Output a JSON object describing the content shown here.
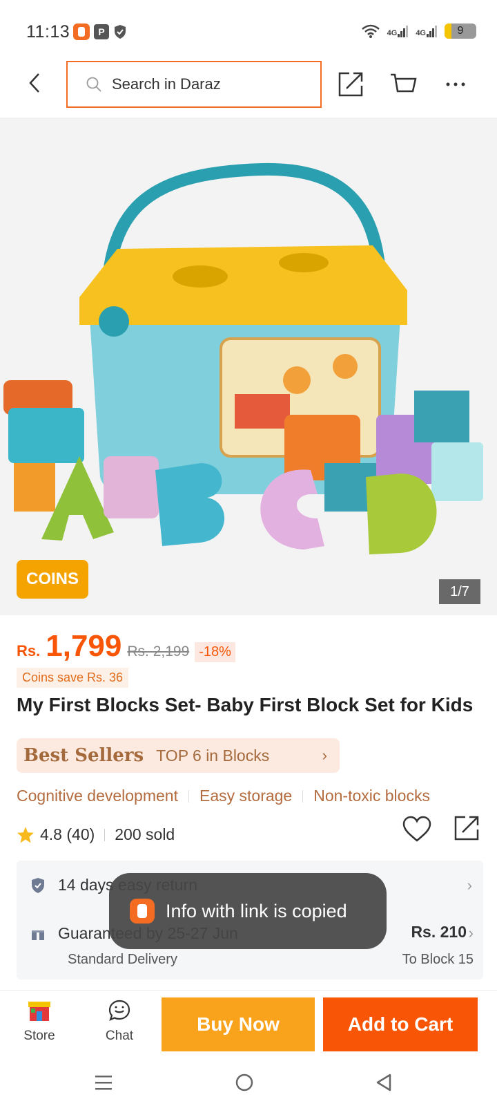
{
  "status_bar": {
    "time": "11:13",
    "net1": "4G",
    "net2": "4G",
    "battery": "9"
  },
  "header": {
    "search_placeholder": "Search in Daraz"
  },
  "gallery": {
    "coins_badge": "COINS",
    "page_indicator": "1/7"
  },
  "price": {
    "currency": "Rs.",
    "current": "1,799",
    "original": "Rs. 2,199",
    "discount": "-18%",
    "coins_save": "Coins save Rs. 36"
  },
  "product": {
    "title": "My First Blocks Set- Baby First Block Set for Kids",
    "best_sellers_label": "Best Sellers",
    "best_sellers_rank": "TOP 6 in Blocks",
    "tags": [
      "Cognitive development",
      "Easy storage",
      "Non-toxic blocks"
    ],
    "rating": "4.8 (40)",
    "sold": "200 sold"
  },
  "info": {
    "return_text": "14 days easy return",
    "guarantee_text": "Guaranteed by 25-27 Jun",
    "delivery_price": "Rs. 210",
    "delivery_type": "Standard Delivery",
    "delivery_to": "To Block 15"
  },
  "toast": {
    "text": "Info with link is copied"
  },
  "action_bar": {
    "store_label": "Store",
    "chat_label": "Chat",
    "buy_now": "Buy Now",
    "add_to_cart": "Add to Cart"
  },
  "colors": {
    "brand_orange": "#f85606",
    "buy_now": "#f9a21b",
    "coins_badge": "#f5a300",
    "best_sellers_text": "#a46a3c"
  }
}
